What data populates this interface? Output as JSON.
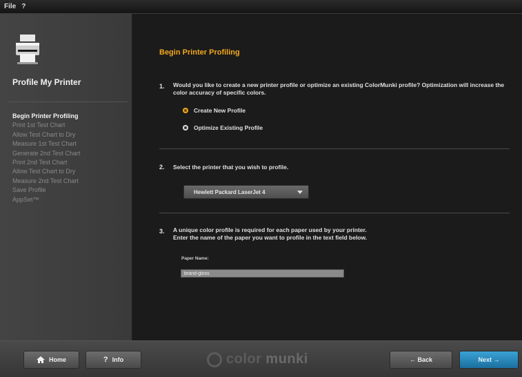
{
  "menu": {
    "file": "File",
    "help": "?"
  },
  "sidebar": {
    "title": "Profile My Printer",
    "steps": [
      {
        "label": "Begin Printer Profiling",
        "active": true
      },
      {
        "label": "Print 1st Test Chart",
        "active": false
      },
      {
        "label": "Allow Test Chart to Dry",
        "active": false
      },
      {
        "label": "Measure 1st Test Chart",
        "active": false
      },
      {
        "label": "Generate 2nd Test Chart",
        "active": false
      },
      {
        "label": "Print 2nd Test Chart",
        "active": false
      },
      {
        "label": "Allow Test Chart to Dry",
        "active": false
      },
      {
        "label": "Measure 2nd Test Chart",
        "active": false
      },
      {
        "label": "Save Profile",
        "active": false
      },
      {
        "label": "AppSet™",
        "active": false
      }
    ]
  },
  "main": {
    "title": "Begin Printer Profiling",
    "q1": {
      "num": "1.",
      "text": "Would you like to create a new printer profile or optimize an existing ColorMunki profile? Optimization will increase the color accuracy of specific colors.",
      "options": [
        {
          "label": "Create New Profile",
          "selected": true
        },
        {
          "label": "Optimize Existing Profile",
          "selected": false
        }
      ]
    },
    "q2": {
      "num": "2.",
      "text": "Select the printer that you wish to profile.",
      "printer_value": "Hewlett Packard LaserJet 4"
    },
    "q3": {
      "num": "3.",
      "text_line1": "A unique color profile is required for each paper used by your printer.",
      "text_line2": "Enter the name of the paper you want to profile in the text field below.",
      "field_label": "Paper Name:",
      "field_value": "brand-gloss"
    }
  },
  "footer": {
    "home_label": "Home",
    "info_label": "Info",
    "logo_text_a": "color",
    "logo_text_b": "munki",
    "back_label": "← Back",
    "next_label": "Next →"
  },
  "colors": {
    "accent": "#f2a81d",
    "next_button": "#2a8cc0"
  }
}
